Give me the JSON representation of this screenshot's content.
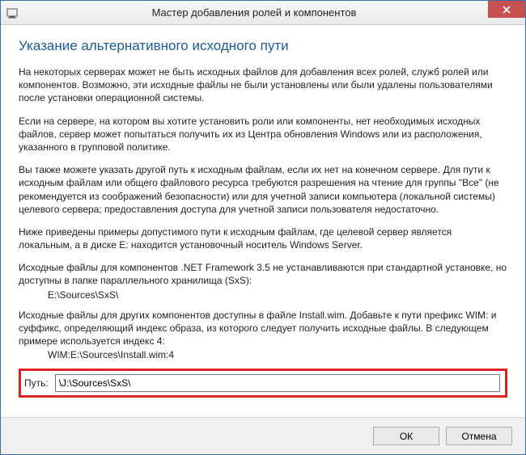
{
  "titlebar": {
    "title": "Мастер добавления ролей и компонентов"
  },
  "heading": "Указание альтернативного исходного пути",
  "paragraphs": {
    "p1": "На некоторых серверах может не быть исходных файлов для добавления всех ролей, служб ролей или компонентов. Возможно, эти исходные файлы не были установлены или были удалены пользователями после установки операционной системы.",
    "p2": "Если на сервере, на котором вы хотите установить роли или компоненты, нет необходимых исходных файлов, сервер может попытаться получить их из Центра обновления Windows или из расположения, указанного в групповой политике.",
    "p3": "Вы также можете указать другой путь к исходным файлам, если их нет на конечном сервере. Для пути к исходным файлам или общего файлового ресурса требуются разрешения на чтение для группы \"Все\" (не рекомендуется из соображений безопасности) или для учетной записи компьютера (локальной системы) целевого сервера; предоставления доступа для учетной записи пользователя недостаточно.",
    "p4": "Ниже приведены примеры допустимого пути к исходным файлам, где целевой сервер является локальным, а в диске E: находится установочный носитель Windows Server.",
    "p5": "Исходные файлы для компонентов .NET Framework 3.5 не устанавливаются при стандартной установке, но доступны в папке параллельного хранилища (SxS):",
    "ex1": "E:\\Sources\\SxS\\",
    "p6": "Исходные файлы для других компонентов доступны в файле Install.wim. Добавьте к пути префикс WIM: и суффикс, определяющий индекс образа, из которого следует получить исходные файлы. В следующем примере используется индекс 4:",
    "ex2": "WIM:E:\\Sources\\Install.wim:4"
  },
  "path": {
    "label": "Путь:",
    "value": "\\J:\\Sources\\SxS\\"
  },
  "buttons": {
    "ok": "ОК",
    "cancel": "Отмена"
  }
}
